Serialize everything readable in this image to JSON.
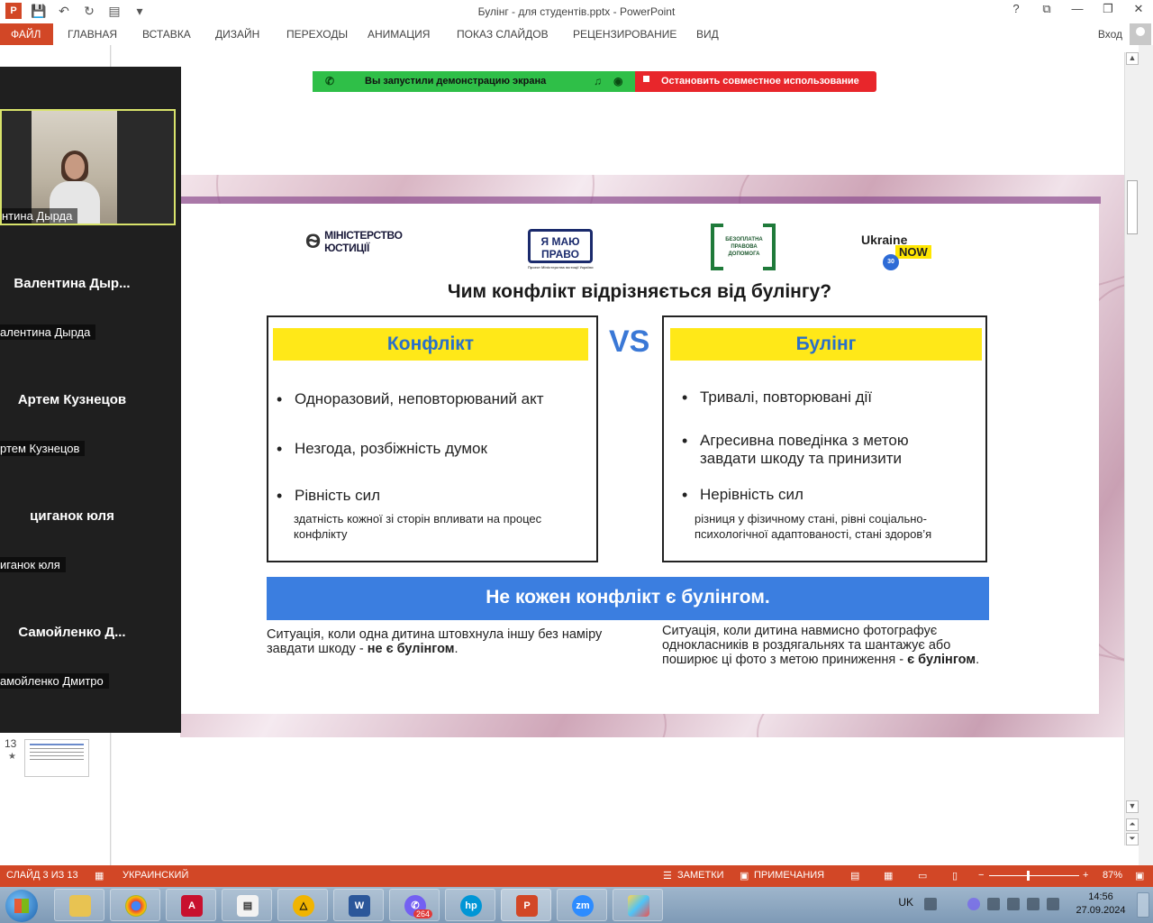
{
  "titlebar": {
    "title": "Булінг - для студентів.pptx - PowerPoint",
    "help": "?",
    "restore": "⧉",
    "minimize": "—",
    "maximize": "❐",
    "close": "✕"
  },
  "ribbon": {
    "tabs": [
      "ФАЙЛ",
      "ГЛАВНАЯ",
      "ВСТАВКА",
      "ДИЗАЙН",
      "ПЕРЕХОДЫ",
      "АНИМАЦИЯ",
      "ПОКАЗ СЛАЙДОВ",
      "РЕЦЕНЗИРОВАНИЕ",
      "ВИД"
    ],
    "signin": "Вход"
  },
  "thumbnails": {
    "slide_number": "13",
    "star": "★"
  },
  "share_bar": {
    "message": "Вы запустили демонстрацию экрана",
    "stop_label": "Остановить совместное использование"
  },
  "zoom_panel": {
    "participants": [
      {
        "label": "нтина Дырда"
      },
      {
        "name": "Валентина  Дыр...",
        "label": "алентина Дырда"
      },
      {
        "name": "Артем Кузнецов",
        "label": "ртем Кузнецов"
      },
      {
        "name": "циганок юля",
        "label": "иганок юля"
      },
      {
        "name": "Самойленко  Д...",
        "label": "амойленко Дмитро"
      }
    ]
  },
  "slide": {
    "logos": {
      "ministry": "МІНІСТЕРСТВО\nЮСТИЦІЇ",
      "pravo": "Я МАЮ\nПРАВО",
      "pravo_sub": "Проект Міністерства юстиції України",
      "legal_aid": "БЕЗОПЛАТНА ПРАВОВА ДОПОМОГА",
      "ukraine_now": "Ukraine",
      "now": "NOW",
      "badge": "30"
    },
    "heading": "Чим конфлікт відрізняється від булінгу?",
    "vs": "VS",
    "conflict": {
      "title": "Конфлікт",
      "b1": "Одноразовий, неповторюваний акт",
      "b2": "Незгода, розбіжність думок",
      "b3": "Рівність сил",
      "b3_sub": "здатність кожної зі сторін впливати на процес конфлікту"
    },
    "bullying": {
      "title": "Булінг",
      "b1": "Тривалі, повторювані дії",
      "b2": "Агресивна поведінка з метою завдати шкоду та принизити",
      "b3": "Нерівність сил",
      "b3_sub": "різниця у фізичному стані, рівні соціально-психологічної адаптованості, стані здоров’я"
    },
    "banner": "Не кожен конфлікт є булінгом.",
    "left_example": "Ситуація, коли одна дитина штовхнула іншу без наміру завдати шкоду - ",
    "left_example_bold": "не є булінгом",
    "right_example": "Ситуація, коли дитина навмисно фотографує однокласників в роздягальнях та шантажує або поширює ці фото з метою приниження - ",
    "right_example_bold": "є булінгом"
  },
  "statusbar": {
    "slide": "СЛАЙД 3 ИЗ 13",
    "language": "УКРАИНСКИЙ",
    "notes": "ЗАМЕТКИ",
    "comments": "ПРИМЕЧАНИЯ",
    "zoom": "87%",
    "minus": "−",
    "plus": "+"
  },
  "taskbar": {
    "apps": [
      "explorer",
      "chrome",
      "acrobat",
      "notepad",
      "archicad",
      "word",
      "viber",
      "hp",
      "powerpoint",
      "zoom",
      "paint"
    ],
    "viber_badge": "264",
    "zoom_label": "zm",
    "word_label": "W",
    "ppt_label": "P",
    "hp_label": "hp",
    "language": "UK",
    "time": "14:56",
    "date": "27.09.2024"
  },
  "colors": {
    "accent": "#d24726",
    "share_green": "#2fbf48",
    "share_red": "#e8262b",
    "banner_blue": "#3b7ee0",
    "highlight_yellow": "#ffe818"
  }
}
